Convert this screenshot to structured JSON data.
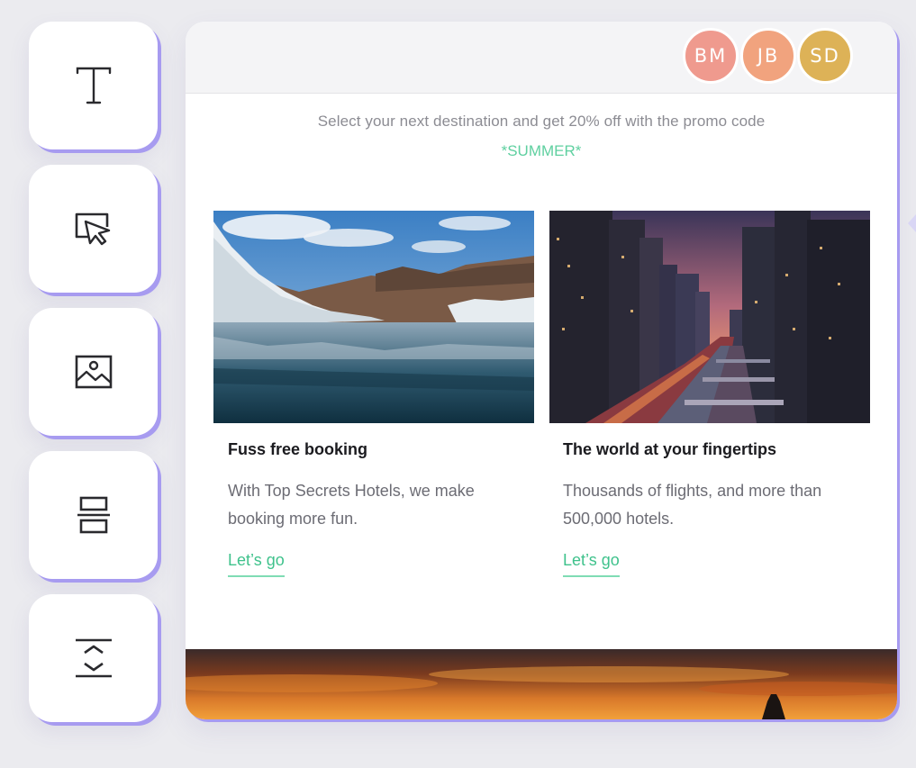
{
  "toolbar": {
    "tools": [
      {
        "name": "text-tool",
        "icon": "text-icon"
      },
      {
        "name": "button-tool",
        "icon": "button-cursor-icon"
      },
      {
        "name": "image-tool",
        "icon": "image-icon"
      },
      {
        "name": "layout-tool",
        "icon": "stacked-layout-icon"
      },
      {
        "name": "spacer-tool",
        "icon": "spacer-icon"
      }
    ]
  },
  "header": {
    "collaborators": [
      {
        "initials": "BM",
        "color": "#ef9a8e"
      },
      {
        "initials": "JB",
        "color": "#f1a37e"
      },
      {
        "initials": "SD",
        "color": "#ddb257"
      }
    ]
  },
  "email": {
    "promo_text": "Select your next destination and get 20% off with the promo code",
    "promo_code": "*SUMMER*",
    "columns": [
      {
        "title": "Fuss free booking",
        "description": "With Top Secrets Hotels, we make booking more fun.",
        "link": "Let’s go",
        "image": "glacier-lake-photo"
      },
      {
        "title": "The world at your fingertips",
        "description": "Thousands of flights, and more than 500,000 hotels.",
        "link": "Let’s go",
        "image": "city-river-night-photo"
      }
    ],
    "banner_image": "sunset-banner-photo"
  },
  "colors": {
    "accent_purple": "#a79bf0",
    "link_green": "#3fc28c",
    "promo_green": "#5fd0a0"
  }
}
